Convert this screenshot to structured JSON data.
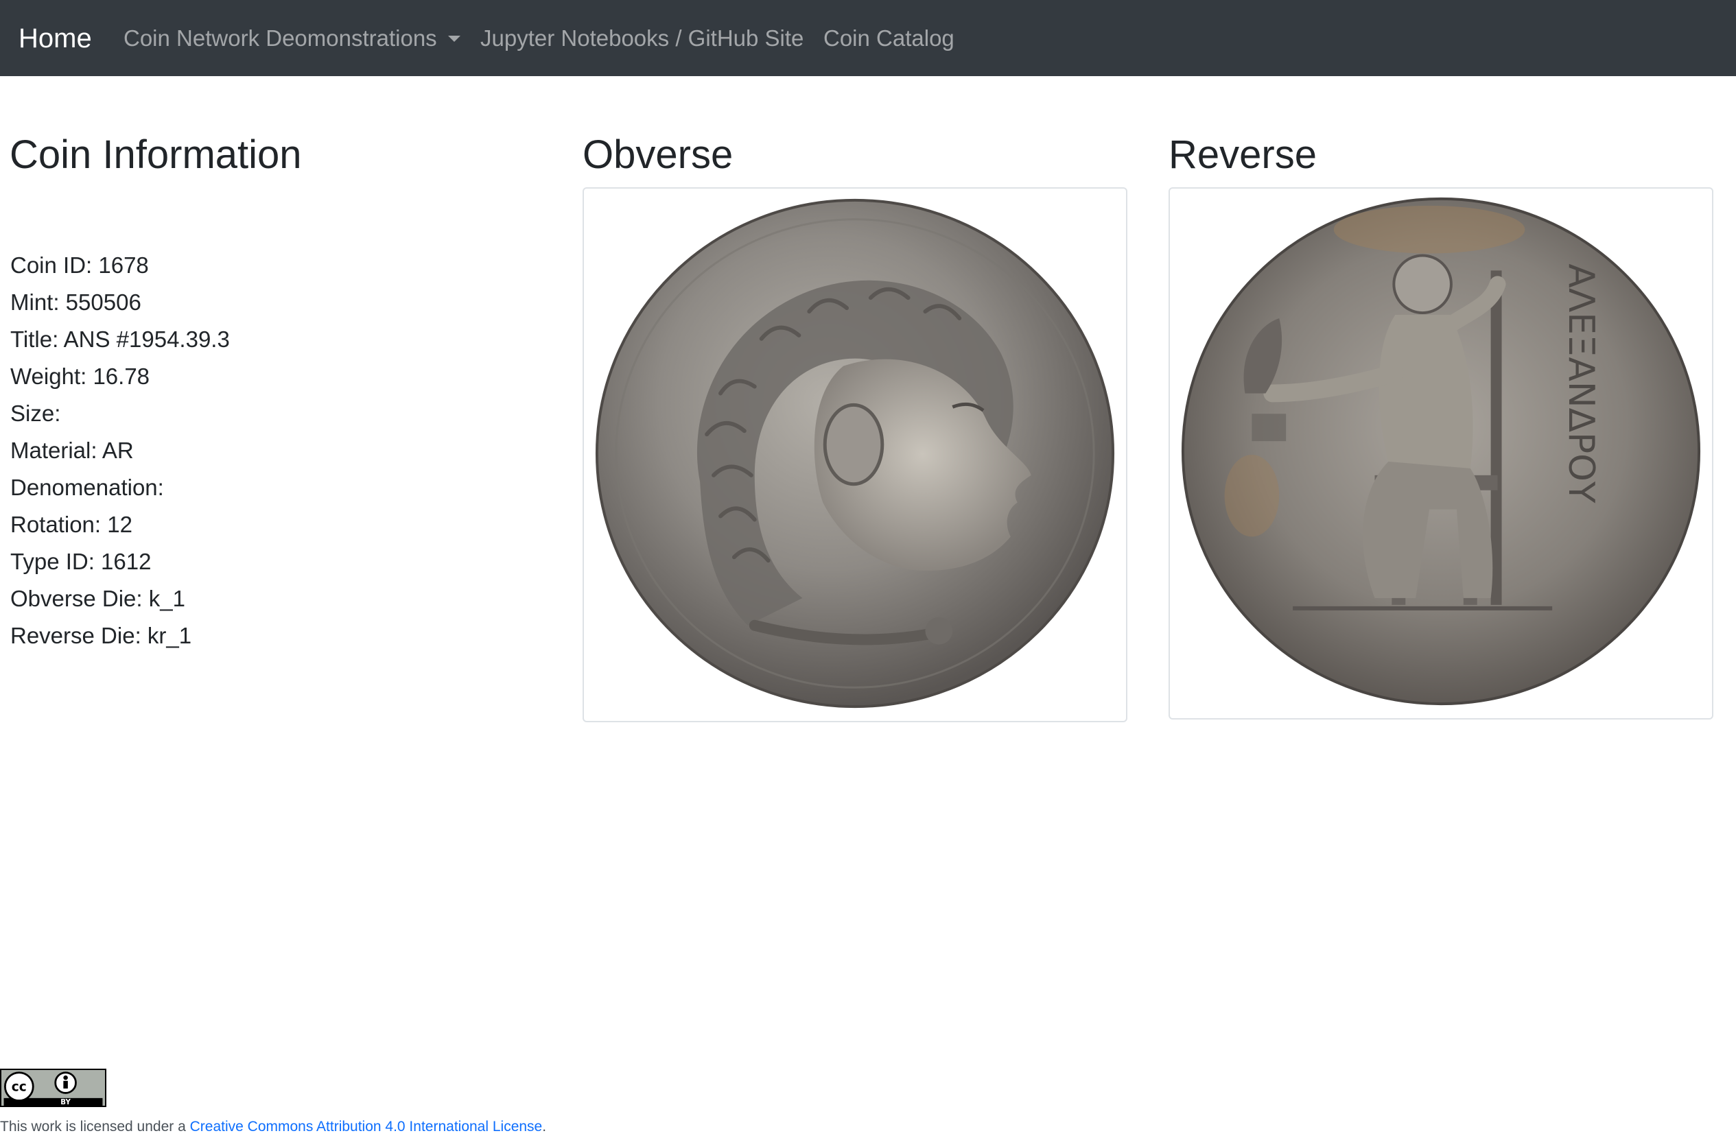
{
  "nav": {
    "brand": "Home",
    "links": [
      {
        "label": "Coin Network Deomonstrations"
      },
      {
        "label": "Jupyter Notebooks / GitHub Site"
      },
      {
        "label": "Coin Catalog"
      }
    ]
  },
  "coin_info": {
    "heading": "Coin Information",
    "fields": [
      "Coin ID: 1678",
      "Mint: 550506",
      "Title: ANS #1954.39.3",
      "Weight: 16.78",
      "Size:",
      "Material: AR",
      "Denomenation:",
      "Rotation: 12",
      "Type ID: 1612",
      "Obverse Die: k_1",
      "Reverse Die: kr_1"
    ]
  },
  "obverse": {
    "heading": "Obverse"
  },
  "reverse": {
    "heading": "Reverse",
    "coin_inscription": "ΑΛΕΞΑΝΔΡΟΥ"
  },
  "footer": {
    "badge_text_cc": "cc",
    "badge_text_by": "BY",
    "license_prefix": "This work is licensed under a ",
    "license_link": "Creative Commons Attribution 4.0 International License",
    "license_suffix": "."
  },
  "colors": {
    "navbar_bg": "#343a40",
    "link": "#0d6efd",
    "coin_silver": "#8e8a85"
  }
}
